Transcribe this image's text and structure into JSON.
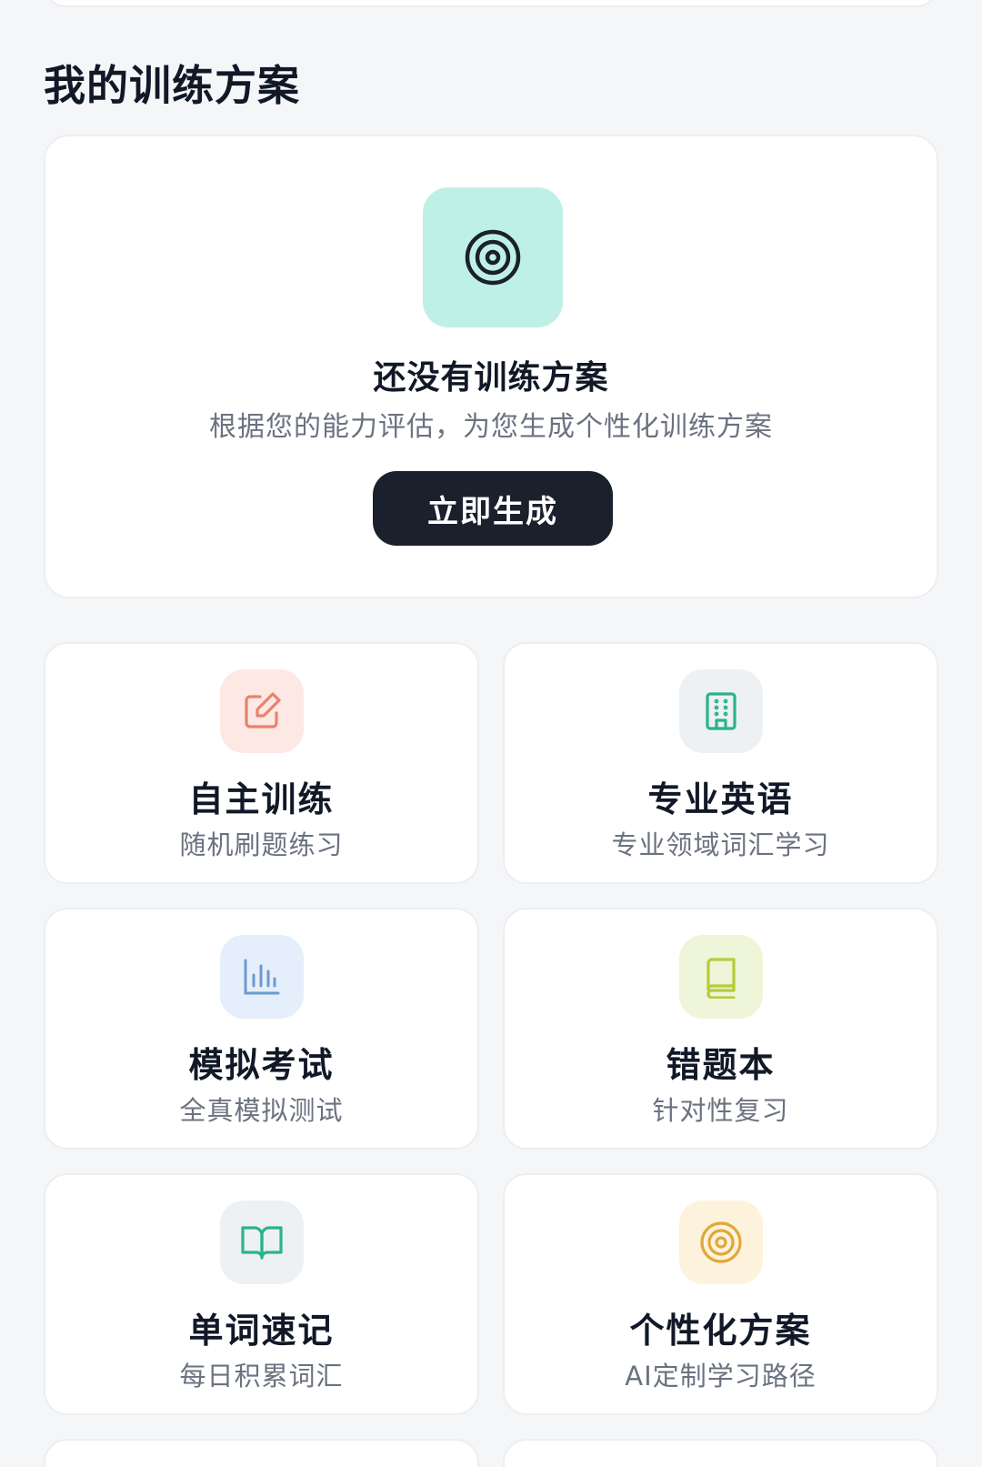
{
  "section": {
    "title": "我的训练方案"
  },
  "plan": {
    "heading": "还没有训练方案",
    "description": "根据您的能力评估，为您生成个性化训练方案",
    "button_label": "立即生成",
    "icon": "target-icon"
  },
  "features": [
    {
      "title": "自主训练",
      "subtitle": "随机刷题练习",
      "icon": "edit-icon",
      "icon_bg": "#fde8e4",
      "icon_color": "#e8826f"
    },
    {
      "title": "专业英语",
      "subtitle": "专业领域词汇学习",
      "icon": "building-icon",
      "icon_bg": "#eef1f4",
      "icon_color": "#2bb38a"
    },
    {
      "title": "模拟考试",
      "subtitle": "全真模拟测试",
      "icon": "bar-chart-icon",
      "icon_bg": "#e5eefb",
      "icon_color": "#6c9bd2"
    },
    {
      "title": "错题本",
      "subtitle": "针对性复习",
      "icon": "book-icon",
      "icon_bg": "#eef5d8",
      "icon_color": "#b5cc3a"
    },
    {
      "title": "单词速记",
      "subtitle": "每日积累词汇",
      "icon": "open-book-icon",
      "icon_bg": "#eef1f4",
      "icon_color": "#2bb38a"
    },
    {
      "title": "个性化方案",
      "subtitle": "AI定制学习路径",
      "icon": "target-icon",
      "icon_bg": "#fdf3dc",
      "icon_color": "#e0a83a"
    }
  ]
}
